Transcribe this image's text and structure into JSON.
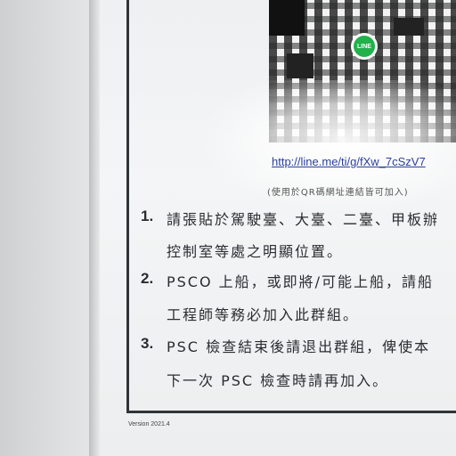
{
  "poster": {
    "qr_logo": "LINE",
    "url": "http://line.me/ti/g/fXw_7cSzV7",
    "note": "(使用於QR碼網址連結皆可加入)",
    "items": [
      {
        "number": "1.",
        "line1": "請張貼於駕駛臺、大臺、二臺、甲板辦",
        "line2": "控制室等處之明顯位置。"
      },
      {
        "number": "2.",
        "line1": "PSCO 上船，或即將/可能上船，請船",
        "line2": "工程師等務必加入此群組。"
      },
      {
        "number": "3.",
        "line1": "PSC 檢查結束後請退出群組，俾使本",
        "line2": "下一次 PSC 檢查時請再加入。"
      }
    ],
    "version": "Version 2021.4"
  },
  "colors": {
    "link": "#2a3f9c",
    "line_green": "#22b14c",
    "border": "#2f3438"
  }
}
